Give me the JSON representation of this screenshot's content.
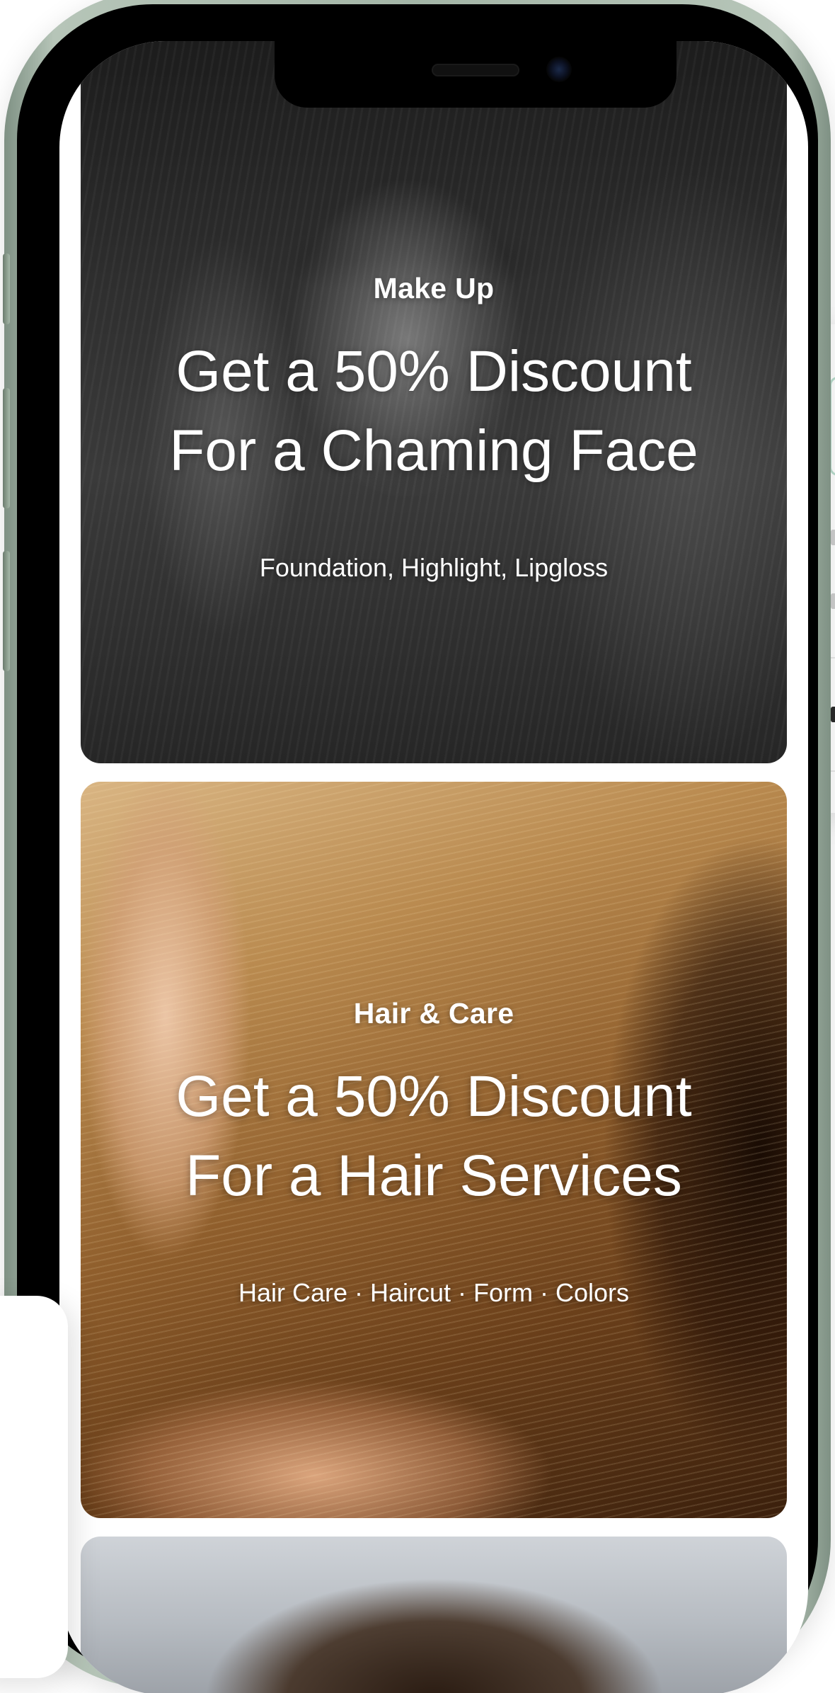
{
  "cards": [
    {
      "category": "Make Up",
      "headline_line1": "Get a 50% Discount",
      "headline_line2": "For a Chaming Face",
      "subtitle": "Foundation, Highlight, Lipgloss"
    },
    {
      "category": "Hair & Care",
      "headline_line1": "Get a 50% Discount",
      "headline_line2": "For a Hair Services",
      "subtitle": "Hair Care · Haircut · Form · Colors"
    }
  ],
  "colors": {
    "phone_frame": "#a4b6a7",
    "screen_bg": "#ffffff",
    "text": "#ffffff"
  }
}
